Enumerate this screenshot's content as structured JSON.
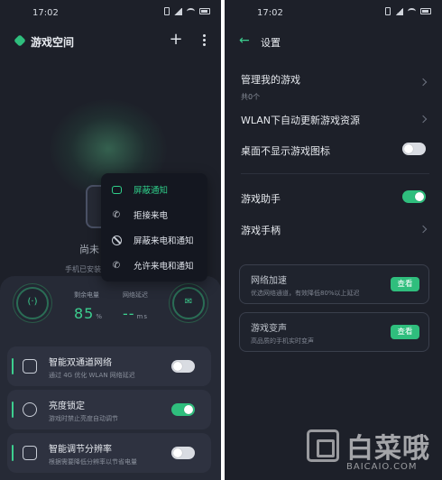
{
  "left": {
    "status_time": "17:02",
    "app_title": "游戏空间",
    "no_game": "尚未",
    "no_game_sub": "手机已安装",
    "popup": {
      "items": [
        "屏蔽通知",
        "拒接来电",
        "屏蔽来电和通知",
        "允许来电和通知"
      ],
      "active_index": 0
    },
    "stats": {
      "battery_label": "剩余电量",
      "battery_value": "85",
      "battery_unit": "%",
      "latency_label": "网络延迟",
      "latency_value": "--",
      "latency_unit": "ms"
    },
    "cards": [
      {
        "title": "智能双通道网络",
        "subtitle": "通过 4G 优化 WLAN 网络延迟",
        "on": false
      },
      {
        "title": "亮度锁定",
        "subtitle": "游戏时禁止亮度自动调节",
        "on": true
      },
      {
        "title": "智能调节分辨率",
        "subtitle": "根据需要降低分辨率以节省电量",
        "on": false
      }
    ]
  },
  "right": {
    "status_time": "17:02",
    "title": "设置",
    "manage_games": "管理我的游戏",
    "manage_games_count": "共0个",
    "wlan_update": "WLAN下自动更新游戏资源",
    "hide_icon": "桌面不显示游戏图标",
    "hide_icon_on": false,
    "game_assistant": "游戏助手",
    "game_assistant_on": true,
    "gamepad": "游戏手柄",
    "net_boost_title": "网络加速",
    "net_boost_sub": "优选网络通道，有效降低80%以上延迟",
    "net_boost_btn": "查看",
    "voice_title": "游戏变声",
    "voice_sub": "高品质的手机实时变声",
    "voice_btn": "查看"
  },
  "watermark": {
    "text": "白菜哦",
    "url": "BAICAIO.COM"
  },
  "colors": {
    "accent": "#2fbe7d",
    "background": "#1d2029",
    "panel": "#262a36"
  }
}
